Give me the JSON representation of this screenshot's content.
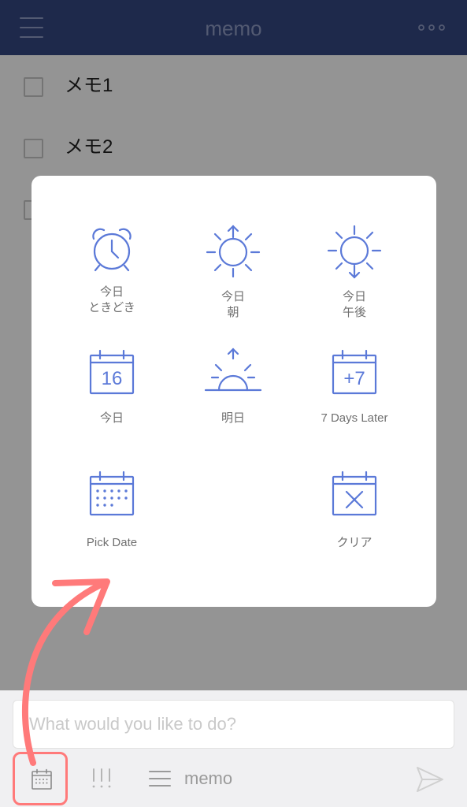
{
  "header": {
    "title": "memo"
  },
  "list": {
    "items": [
      {
        "label": "メモ1"
      },
      {
        "label": "メモ2"
      },
      {
        "label": ""
      }
    ]
  },
  "dialog": {
    "options": [
      {
        "label": "今日\nときどき",
        "icon": "alarm-clock-icon"
      },
      {
        "label": "今日\n朝",
        "icon": "sunrise-icon"
      },
      {
        "label": "今日\n午後",
        "icon": "sunset-icon"
      },
      {
        "label": "今日",
        "icon": "calendar-today-icon",
        "icon_text": "16"
      },
      {
        "label": "明日",
        "icon": "horizon-sun-icon"
      },
      {
        "label": "7 Days Later",
        "icon": "calendar-plus-seven-icon",
        "icon_text": "+7"
      },
      {
        "label": "Pick Date",
        "icon": "calendar-grid-icon"
      },
      {
        "label": "クリア",
        "icon": "calendar-clear-icon"
      }
    ]
  },
  "bottom_bar": {
    "input_placeholder": "What would you like to do?",
    "list_label": "memo"
  },
  "colors": {
    "header_bg": "#354782",
    "header_text": "#8f9bc4",
    "icon_blue": "#5b79d8",
    "highlight": "#ff7a7a",
    "label_gray": "#707070"
  }
}
